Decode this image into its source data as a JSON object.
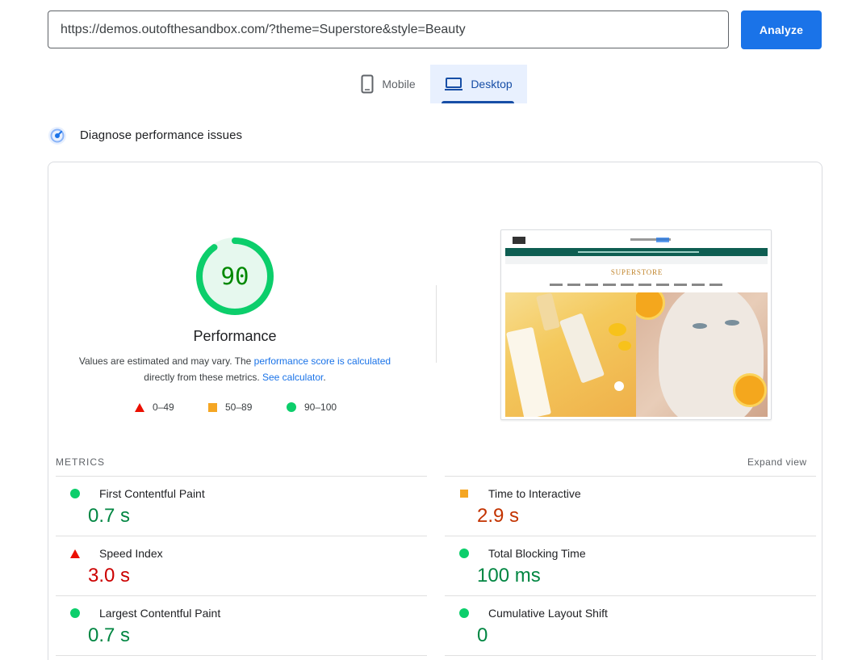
{
  "url_bar": {
    "value": "https://demos.outofthesandbox.com/?theme=Superstore&style=Beauty",
    "analyze_label": "Analyze"
  },
  "tabs": [
    {
      "label": "Mobile",
      "icon": "smartphone-icon",
      "active": false
    },
    {
      "label": "Desktop",
      "icon": "laptop-icon",
      "active": true
    }
  ],
  "diagnose": {
    "title": "Diagnose performance issues",
    "icon": "gauge-icon"
  },
  "score": {
    "value": "90",
    "value_fraction": 0.9,
    "label": "Performance",
    "desc_prefix": "Values are estimated and may vary. The ",
    "desc_link1": "performance score is calculated",
    "desc_middle": " directly from these metrics. ",
    "desc_link2": "See calculator",
    "desc_suffix": ".",
    "legend": [
      {
        "range": "0–49",
        "icon": "triangle-icon",
        "color": "#eb0f00"
      },
      {
        "range": "50–89",
        "icon": "square-icon",
        "color": "#f5a623"
      },
      {
        "range": "90–100",
        "icon": "circle-icon",
        "color": "#0cce6b"
      }
    ],
    "colors": {
      "pass_ring": "#0cce6b",
      "pass_fill": "#e6f8ee",
      "pass_text": "#008800"
    }
  },
  "thumbnail": {
    "brand": "SUPERSTORE"
  },
  "metrics": {
    "heading": "METRICS",
    "expand_label": "Expand view",
    "items": [
      {
        "name": "First Contentful Paint",
        "value": "0.7 s",
        "rating": "pass"
      },
      {
        "name": "Time to Interactive",
        "value": "2.9 s",
        "rating": "average"
      },
      {
        "name": "Speed Index",
        "value": "3.0 s",
        "rating": "fail"
      },
      {
        "name": "Total Blocking Time",
        "value": "100 ms",
        "rating": "pass"
      },
      {
        "name": "Largest Contentful Paint",
        "value": "0.7 s",
        "rating": "pass"
      },
      {
        "name": "Cumulative Layout Shift",
        "value": "0",
        "rating": "pass"
      }
    ]
  },
  "colors": {
    "accent": "#1a73e8",
    "tab_active_bg": "#e8f0fe",
    "tab_active_text": "#174ea6"
  }
}
